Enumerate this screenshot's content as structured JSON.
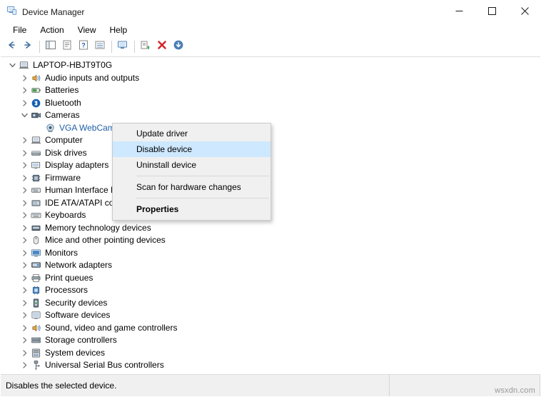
{
  "window": {
    "title": "Device Manager",
    "app_icon": "device-manager-icon",
    "minimize_label": "Minimize",
    "maximize_label": "Maximize",
    "close_label": "Close"
  },
  "menubar": {
    "items": [
      {
        "label": "File",
        "name": "menu-file"
      },
      {
        "label": "Action",
        "name": "menu-action"
      },
      {
        "label": "View",
        "name": "menu-view"
      },
      {
        "label": "Help",
        "name": "menu-help"
      }
    ]
  },
  "toolbar": {
    "buttons": [
      {
        "name": "back-button",
        "icon": "back-arrow-icon"
      },
      {
        "name": "forward-button",
        "icon": "forward-arrow-icon"
      },
      {
        "name": "show-hide-console-tree-button",
        "icon": "console-tree-icon"
      },
      {
        "name": "properties-button",
        "icon": "properties-icon"
      },
      {
        "name": "help-button",
        "icon": "help-question-icon"
      },
      {
        "name": "view-button",
        "icon": "view-list-icon"
      },
      {
        "name": "scan-hardware-changes-button",
        "icon": "monitor-scan-icon"
      },
      {
        "name": "update-driver-button",
        "icon": "update-driver-icon"
      },
      {
        "name": "uninstall-device-button",
        "icon": "red-x-icon"
      },
      {
        "name": "disable-device-button",
        "icon": "down-arrow-circle-icon"
      }
    ]
  },
  "tree": {
    "root": {
      "label": "LAPTOP-HBJT9T0G",
      "icon": "computer-icon",
      "expanded": true
    },
    "nodes": [
      {
        "label": "Audio inputs and outputs",
        "icon": "speaker-icon",
        "expanded": false,
        "selected": false
      },
      {
        "label": "Batteries",
        "icon": "battery-icon",
        "expanded": false,
        "selected": false
      },
      {
        "label": "Bluetooth",
        "icon": "bluetooth-icon",
        "expanded": false,
        "selected": false
      },
      {
        "label": "Cameras",
        "icon": "camera-icon",
        "expanded": true,
        "selected": false
      },
      {
        "label": "VGA WebCam",
        "icon": "webcam-device-icon",
        "expanded": null,
        "selected": true,
        "child": true
      },
      {
        "label": "Computer",
        "icon": "computer-icon",
        "expanded": false,
        "selected": false
      },
      {
        "label": "Disk drives",
        "icon": "disk-drive-icon",
        "expanded": false,
        "selected": false
      },
      {
        "label": "Display adapters",
        "icon": "display-adapter-icon",
        "expanded": false,
        "selected": false
      },
      {
        "label": "Firmware",
        "icon": "firmware-icon",
        "expanded": false,
        "selected": false
      },
      {
        "label": "Human Interface Devices",
        "icon": "hid-icon",
        "expanded": false,
        "selected": false
      },
      {
        "label": "IDE ATA/ATAPI controllers",
        "icon": "ide-controller-icon",
        "expanded": false,
        "selected": false
      },
      {
        "label": "Keyboards",
        "icon": "keyboard-icon",
        "expanded": false,
        "selected": false
      },
      {
        "label": "Memory technology devices",
        "icon": "memory-icon",
        "expanded": false,
        "selected": false
      },
      {
        "label": "Mice and other pointing devices",
        "icon": "mouse-icon",
        "expanded": false,
        "selected": false
      },
      {
        "label": "Monitors",
        "icon": "monitor-icon",
        "expanded": false,
        "selected": false
      },
      {
        "label": "Network adapters",
        "icon": "network-adapter-icon",
        "expanded": false,
        "selected": false
      },
      {
        "label": "Print queues",
        "icon": "printer-icon",
        "expanded": false,
        "selected": false
      },
      {
        "label": "Processors",
        "icon": "processor-icon",
        "expanded": false,
        "selected": false
      },
      {
        "label": "Security devices",
        "icon": "security-chip-icon",
        "expanded": false,
        "selected": false
      },
      {
        "label": "Software devices",
        "icon": "software-device-icon",
        "expanded": false,
        "selected": false
      },
      {
        "label": "Sound, video and game controllers",
        "icon": "sound-controller-icon",
        "expanded": false,
        "selected": false
      },
      {
        "label": "Storage controllers",
        "icon": "storage-controller-icon",
        "expanded": false,
        "selected": false
      },
      {
        "label": "System devices",
        "icon": "system-device-icon",
        "expanded": false,
        "selected": false
      },
      {
        "label": "Universal Serial Bus controllers",
        "icon": "usb-controller-icon",
        "expanded": false,
        "selected": false
      }
    ]
  },
  "context_menu": {
    "items": [
      {
        "label": "Update driver",
        "name": "context-update-driver",
        "highlight": false,
        "bold": false
      },
      {
        "label": "Disable device",
        "name": "context-disable-device",
        "highlight": true,
        "bold": false
      },
      {
        "label": "Uninstall device",
        "name": "context-uninstall-device",
        "highlight": false,
        "bold": false
      },
      {
        "label": "Scan for hardware changes",
        "name": "context-scan-hardware-changes",
        "highlight": false,
        "bold": false,
        "separator_before": true
      },
      {
        "label": "Properties",
        "name": "context-properties",
        "highlight": false,
        "bold": true,
        "separator_before": true
      }
    ]
  },
  "statusbar": {
    "message": "Disables the selected device."
  },
  "watermark": {
    "text": "wsxdn.com"
  },
  "colors": {
    "selection_blue": "#cde8ff",
    "selected_text": "#1f5fa8",
    "status_bg": "#f0f0f0",
    "accent_red": "#d7262a"
  }
}
